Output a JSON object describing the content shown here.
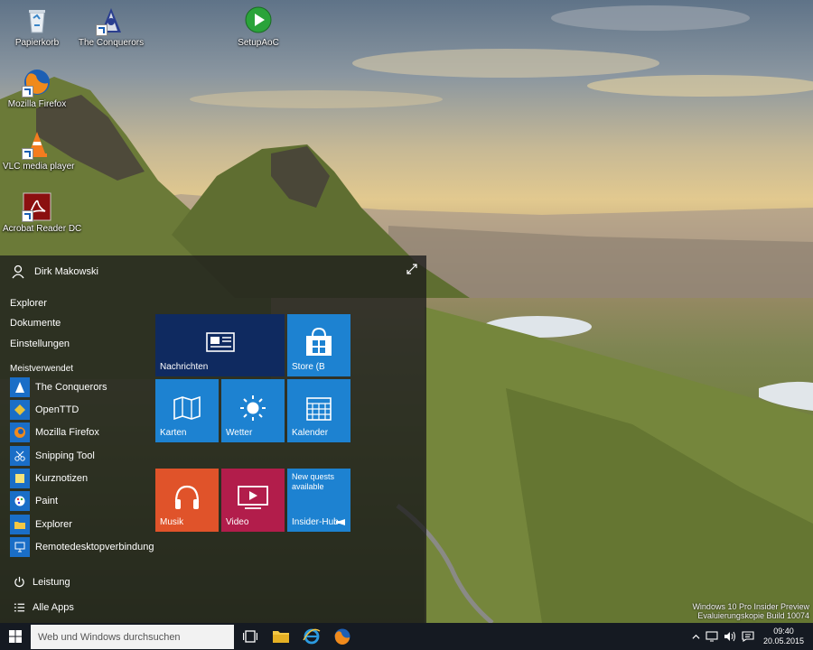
{
  "desktop": {
    "icons": [
      {
        "label": "Papierkorb"
      },
      {
        "label": "The Conquerors"
      },
      {
        "label": "SetupAoC"
      },
      {
        "label": "Mozilla Firefox"
      },
      {
        "label": "VLC media player"
      },
      {
        "label": "Acrobat Reader DC"
      }
    ]
  },
  "start_menu": {
    "user_name": "Dirk Makowski",
    "links": [
      "Explorer",
      "Dokumente",
      "Einstellungen"
    ],
    "most_used_heading": "Meistverwendet",
    "most_used": [
      {
        "label": "The Conquerors"
      },
      {
        "label": "OpenTTD"
      },
      {
        "label": "Mozilla Firefox"
      },
      {
        "label": "Snipping Tool"
      },
      {
        "label": "Kurznotizen"
      },
      {
        "label": "Paint"
      },
      {
        "label": "Explorer"
      },
      {
        "label": "Remotedesktopverbindung"
      }
    ],
    "power_label": "Leistung",
    "all_apps_label": "Alle Apps",
    "tiles": {
      "nachrichten": "Nachrichten",
      "store": "Store (B",
      "karten": "Karten",
      "wetter": "Wetter",
      "kalender": "Kalender",
      "musik": "Musik",
      "video": "Video",
      "insider_msg": "New quests available",
      "insider": "Insider-Hub"
    }
  },
  "taskbar": {
    "search_placeholder": "Web und Windows durchsuchen",
    "time": "09:40",
    "date": "20.05.2015"
  },
  "watermark": {
    "line1": "Windows 10 Pro Insider Preview",
    "line2": "Evaluierungskopie Build 10074"
  },
  "colors": {
    "tile_dark_blue": "#0f2a60",
    "tile_blue": "#1d82d1",
    "tile_orange": "#e0532a",
    "tile_magenta": "#b21d4b",
    "taskbar": "#151a22"
  }
}
